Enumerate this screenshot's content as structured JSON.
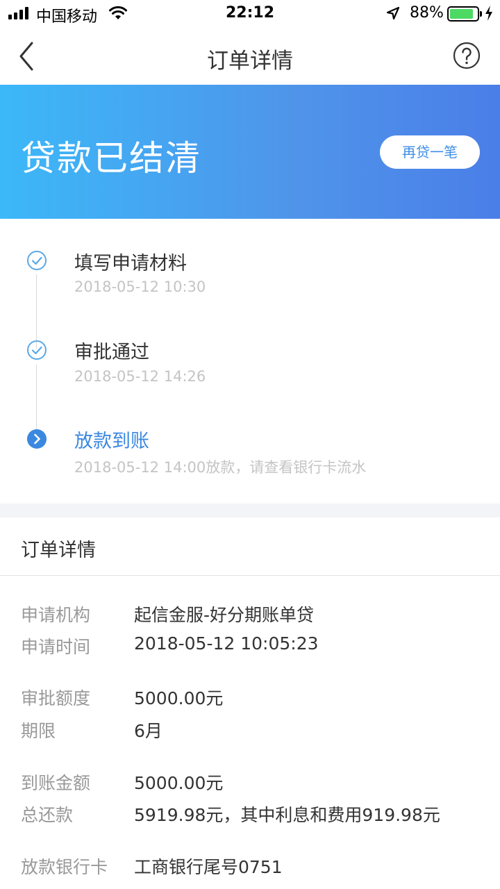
{
  "status_bar": {
    "carrier": "中国移动",
    "time": "22:12",
    "battery": "88%",
    "battery_level": 0.88
  },
  "nav": {
    "title": "订单详情",
    "back_icon": "chevron-left-icon",
    "help_icon": "question-circle-icon"
  },
  "banner": {
    "status": "贷款已结清",
    "button_label": "再贷一笔"
  },
  "timeline": [
    {
      "title": "填写申请材料",
      "time": "2018-05-12 10:30",
      "state": "done"
    },
    {
      "title": "审批通过",
      "time": "2018-05-12 14:26",
      "state": "done"
    },
    {
      "title": "放款到账",
      "time": "2018-05-12 14:00放款，请查看银行卡流水",
      "state": "active"
    }
  ],
  "details": {
    "title": "订单详情",
    "rows": [
      {
        "label": "申请机构",
        "value": "起信金服-好分期账单贷"
      },
      {
        "label": "申请时间",
        "value": "2018-05-12 10:05:23"
      },
      {
        "label": "审批额度",
        "value": "5000.00元"
      },
      {
        "label": "期限",
        "value": "6月"
      },
      {
        "label": "到账金额",
        "value": "5000.00元"
      },
      {
        "label": "总还款",
        "value": "5919.98元，其中利息和费用919.98元"
      },
      {
        "label": "放款银行卡",
        "value": "工商银行尾号0751"
      }
    ]
  },
  "colors": {
    "accent": "#3b88e0",
    "banner_start": "#3cb8f8",
    "banner_end": "#4a7ee8",
    "label_gray": "#999999",
    "time_gray": "#c4c4c4"
  }
}
